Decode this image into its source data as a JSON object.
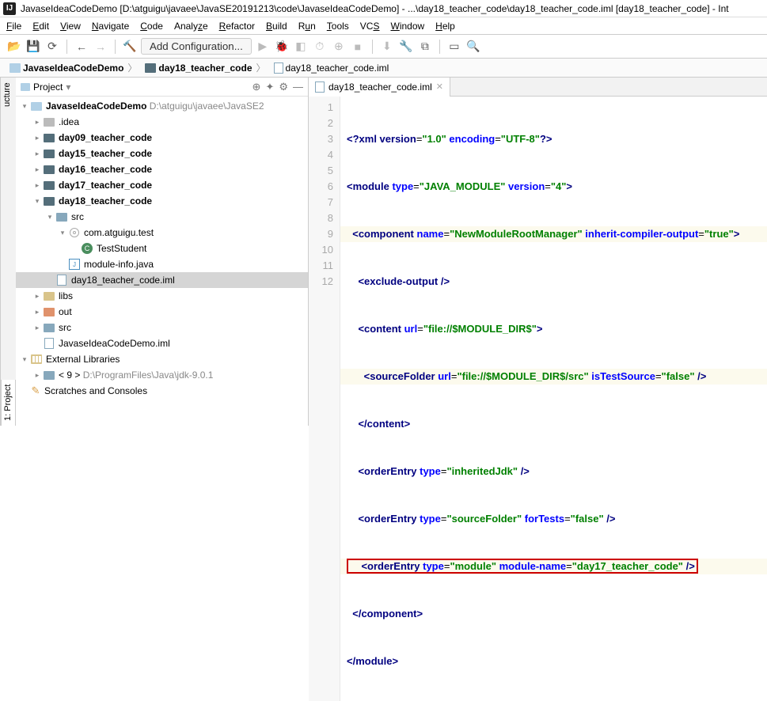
{
  "title": "JavaseIdeaCodeDemo [D:\\atguigu\\javaee\\JavaSE20191213\\code\\JavaseIdeaCodeDemo] - ...\\day18_teacher_code\\day18_teacher_code.iml [day18_teacher_code] - Int",
  "menu": {
    "file": "File",
    "edit": "Edit",
    "view": "View",
    "navigate": "Navigate",
    "code": "Code",
    "analyze": "Analyze",
    "refactor": "Refactor",
    "build": "Build",
    "run": "Run",
    "tools": "Tools",
    "vcs": "VCS",
    "window": "Window",
    "help": "Help"
  },
  "toolbar": {
    "config": "Add Configuration..."
  },
  "breadcrumb": {
    "root": "JavaseIdeaCodeDemo",
    "mod": "day18_teacher_code",
    "file": "day18_teacher_code.iml"
  },
  "panel": {
    "title": "Project",
    "tabSide1": "1: Project",
    "tabSide2": "ucture"
  },
  "tree": {
    "root": "JavaseIdeaCodeDemo",
    "rootPath": "D:\\atguigu\\javaee\\JavaSE2",
    "idea": ".idea",
    "d09": "day09_teacher_code",
    "d15": "day15_teacher_code",
    "d16": "day16_teacher_code",
    "d17": "day17_teacher_code",
    "d18": "day18_teacher_code",
    "src": "src",
    "pkg": "com.atguigu.test",
    "cls": "TestStudent",
    "modinfo": "module-info.java",
    "iml": "day18_teacher_code.iml",
    "libs": "libs",
    "out": "out",
    "srcroot": "src",
    "rootiml": "JavaseIdeaCodeDemo.iml",
    "ext": "External Libraries",
    "jdk": "< 9 >",
    "jdkPath": "D:\\ProgramFiles\\Java\\jdk-9.0.1",
    "scratch": "Scratches and Consoles"
  },
  "tab": {
    "name": "day18_teacher_code.iml"
  },
  "code": {
    "l1a": "<?",
    "l1b": "xml version",
    "l1c": "=",
    "l1d": "\"1.0\"",
    "l1e": " encoding",
    "l1f": "=",
    "l1g": "\"UTF-8\"",
    "l1h": "?>",
    "l2a": "<",
    "l2b": "module ",
    "l2c": "type",
    "l2d": "=",
    "l2e": "\"JAVA_MODULE\"",
    "l2f": " version",
    "l2g": "=",
    "l2h": "\"4\"",
    "l2i": ">",
    "l3a": "  <",
    "l3b": "component ",
    "l3c": "name",
    "l3d": "=",
    "l3e": "\"NewModuleRootManager\"",
    "l3f": " inherit-compiler-output",
    "l3g": "=",
    "l3h": "\"true\"",
    "l3i": ">",
    "l4a": "    <",
    "l4b": "exclude-output ",
    "l4c": "/>",
    "l5a": "    <",
    "l5b": "content ",
    "l5c": "url",
    "l5d": "=",
    "l5e": "\"file://$MODULE_DIR$\"",
    "l5f": ">",
    "l6a": "      <",
    "l6b": "sourceFolder ",
    "l6c": "url",
    "l6d": "=",
    "l6e": "\"file://$MODULE_DIR$/src\"",
    "l6f": " isTestSource",
    "l6g": "=",
    "l6h": "\"false\"",
    "l6i": " />",
    "l7a": "    </",
    "l7b": "content",
    "l7c": ">",
    "l8a": "    <",
    "l8b": "orderEntry ",
    "l8c": "type",
    "l8d": "=",
    "l8e": "\"inheritedJdk\"",
    "l8f": " />",
    "l9a": "    <",
    "l9b": "orderEntry ",
    "l9c": "type",
    "l9d": "=",
    "l9e": "\"sourceFolder\"",
    "l9f": " forTests",
    "l9g": "=",
    "l9h": "\"false\"",
    "l9i": " />",
    "l10a": "    <",
    "l10b": "orderEntry ",
    "l10c": "type",
    "l10d": "=",
    "l10e": "\"module\"",
    "l10f": " module-name",
    "l10g": "=",
    "l10h": "\"day17_teacher_code\"",
    "l10i": " />",
    "l11a": "  </",
    "l11b": "component",
    "l11c": ">",
    "l12a": "</",
    "l12b": "module",
    "l12c": ">"
  }
}
